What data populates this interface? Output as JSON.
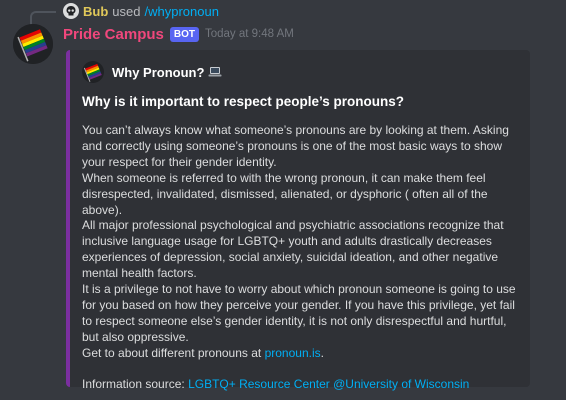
{
  "colors": {
    "background": "#36393f",
    "embed_background": "#2f3136",
    "embed_accent": "#7b2fa0",
    "username": "#f0477c",
    "reply_user": "#e0c85a",
    "link": "#00aff4",
    "bot_tag": "#5865f2"
  },
  "reply": {
    "user": "Bub",
    "used": "used",
    "command": "/whypronoun",
    "avatar_icon": "skull-avatar-icon"
  },
  "message": {
    "username": "Pride Campus",
    "bot_tag": "BOT",
    "timestamp": "Today at 9:48 AM",
    "avatar_icon": "rainbow-flag-avatar"
  },
  "embed": {
    "author": "Why Pronoun?",
    "author_icon": "rainbow-flag-icon",
    "author_emoji": "laptop-icon",
    "title": "Why is it important to respect people’s pronouns?",
    "paragraphs": [
      "You can’t always know what someone’s pronouns are by looking at them. Asking and correctly using someone’s pronouns is one of the most basic ways to show your respect for their gender identity.",
      "When someone is referred to with the wrong pronoun, it can make them feel disrespected, invalidated, dismissed, alienated, or dysphoric ( often all of the above).",
      "All major professional psychological and psychiatric associations recognize that inclusive language usage for LGBTQ+ youth and adults drastically decreases experiences of depression, social anxiety, suicidal ideation, and other negative mental health factors.",
      "It is a privilege to not have to worry about which pronoun someone is going to use for you based on how they perceive your gender. If you have this privilege, yet fail to respect someone else’s gender identity, it is not only disrespectful and hurtful, but also oppressive."
    ],
    "get_text": "Get to about different pronouns at ",
    "get_link": "pronoun.is",
    "get_suffix": ".",
    "source_label": "Information source: ",
    "source_link": "LGBTQ+ Resource Center @University of Wisconsin"
  }
}
